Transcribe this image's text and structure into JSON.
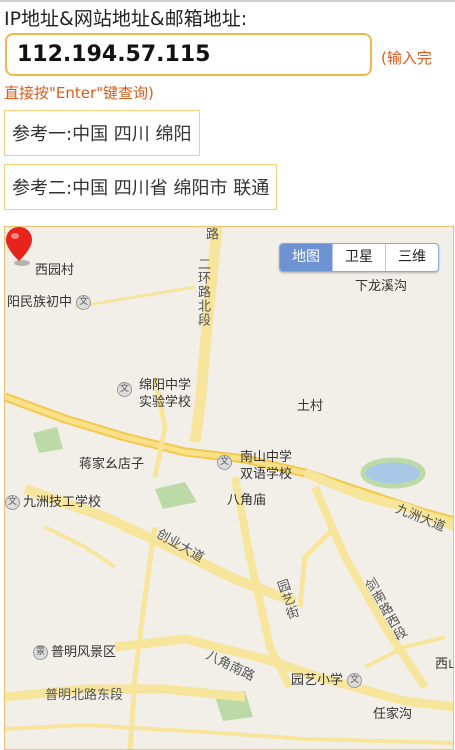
{
  "form": {
    "label": "IP地址&网站地址&邮箱地址:",
    "input_value": "112.194.57.115",
    "hint_right": "(输入完",
    "hint_below": "直接按\"Enter\"键查询)"
  },
  "results": {
    "ref1": "参考一:中国 四川 绵阳",
    "ref2": "参考二:中国 四川省 绵阳市 联通"
  },
  "map": {
    "type_buttons": [
      "地图",
      "卫星",
      "三维"
    ],
    "active_type": "地图",
    "labels": {
      "xiyuancun": "西园村",
      "minzu": "阳民族初中",
      "xialong": "下龙溪沟",
      "mianyang_zhongxue_1": "绵阳中学",
      "mianyang_zhongxue_2": "实验学校",
      "village": "土村",
      "jiangjia": "蒋家幺店子",
      "nanshan_1": "南山中学",
      "nanshan_2": "双语学校",
      "jiuzhou_tech": "九洲技工学校",
      "bajiao": "八角庙",
      "jiuzhou_ave": "九洲大道",
      "chuangye": "创业大道",
      "puming_scenic": "普明风景区",
      "yuanyi_street": "园艺街",
      "jiannan": "剑南路西段",
      "bajiao_south": "八角南路",
      "yuanyi_school": "园艺小学",
      "puming_north": "普明北路东段",
      "renjia": "任家沟",
      "xishan": "西山",
      "ring_road": "二环路北段",
      "road_top": "路"
    }
  }
}
